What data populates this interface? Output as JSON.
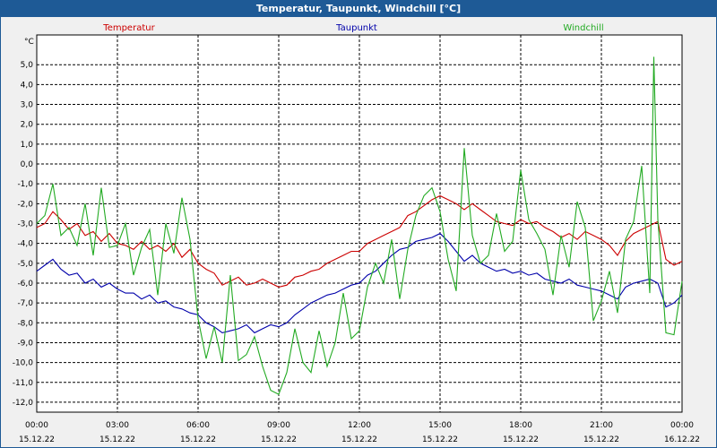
{
  "window": {
    "title": "Temperatur, Taupunkt, Windchill [°C]"
  },
  "colors": {
    "titlebar": "#1e5a96",
    "temperature": "#cc0000",
    "dewpoint": "#0000aa",
    "windchill": "#22aa22",
    "grid": "#000000"
  },
  "chart_data": {
    "type": "line",
    "ylabel": "°C",
    "ylim": [
      -12.5,
      6.5
    ],
    "xlim": [
      0,
      24
    ],
    "grid": true,
    "legend_placement": "top",
    "yticks": [
      "5,0",
      "4,0",
      "3,0",
      "2,0",
      "1,0",
      "0,0",
      "-1,0",
      "-2,0",
      "-3,0",
      "-4,0",
      "-5,0",
      "-6,0",
      "-7,0",
      "-8,0",
      "-9,0",
      "-10,0",
      "-11,0",
      "-12,0"
    ],
    "ytick_values": [
      5,
      4,
      3,
      2,
      1,
      0,
      -1,
      -2,
      -3,
      -4,
      -5,
      -6,
      -7,
      -8,
      -9,
      -10,
      -11,
      -12
    ],
    "xticks": [
      {
        "time": "00:00",
        "date": "15.12.22"
      },
      {
        "time": "03:00",
        "date": "15.12.22"
      },
      {
        "time": "06:00",
        "date": "15.12.22"
      },
      {
        "time": "09:00",
        "date": "15.12.22"
      },
      {
        "time": "12:00",
        "date": "15.12.22"
      },
      {
        "time": "15:00",
        "date": "15.12.22"
      },
      {
        "time": "18:00",
        "date": "15.12.22"
      },
      {
        "time": "21:00",
        "date": "15.12.22"
      },
      {
        "time": "00:00",
        "date": "16.12.22"
      }
    ],
    "series": [
      {
        "name": "Temperatur",
        "color": "#cc0000",
        "x": [
          0,
          0.3,
          0.6,
          0.9,
          1.2,
          1.5,
          1.8,
          2.1,
          2.4,
          2.7,
          3.0,
          3.3,
          3.6,
          3.9,
          4.2,
          4.5,
          4.8,
          5.1,
          5.4,
          5.7,
          6.0,
          6.3,
          6.6,
          6.9,
          7.2,
          7.5,
          7.8,
          8.1,
          8.4,
          8.7,
          9.0,
          9.3,
          9.6,
          9.9,
          10.2,
          10.5,
          10.8,
          11.1,
          11.4,
          11.7,
          12.0,
          12.3,
          12.6,
          12.9,
          13.2,
          13.5,
          13.8,
          14.1,
          14.4,
          14.7,
          15.0,
          15.3,
          15.6,
          15.9,
          16.2,
          16.5,
          16.8,
          17.1,
          17.4,
          17.7,
          18.0,
          18.3,
          18.6,
          18.9,
          19.2,
          19.5,
          19.8,
          20.1,
          20.4,
          20.7,
          21.0,
          21.3,
          21.6,
          21.9,
          22.2,
          22.5,
          22.8,
          23.1,
          23.4,
          23.7,
          24.0
        ],
        "values": [
          -3.2,
          -3.0,
          -2.4,
          -2.8,
          -3.3,
          -3.0,
          -3.6,
          -3.4,
          -3.9,
          -3.5,
          -4.0,
          -4.1,
          -4.3,
          -3.9,
          -4.3,
          -4.1,
          -4.4,
          -4.0,
          -4.7,
          -4.3,
          -5.0,
          -5.3,
          -5.5,
          -6.1,
          -5.9,
          -5.7,
          -6.1,
          -6.0,
          -5.8,
          -6.0,
          -6.2,
          -6.1,
          -5.7,
          -5.6,
          -5.4,
          -5.3,
          -5.0,
          -4.8,
          -4.6,
          -4.4,
          -4.4,
          -4.0,
          -3.8,
          -3.6,
          -3.4,
          -3.2,
          -2.6,
          -2.4,
          -2.1,
          -1.8,
          -1.6,
          -1.8,
          -2.0,
          -2.3,
          -2.0,
          -2.3,
          -2.6,
          -2.9,
          -3.0,
          -3.1,
          -2.8,
          -3.0,
          -2.9,
          -3.2,
          -3.4,
          -3.7,
          -3.5,
          -3.8,
          -3.4,
          -3.6,
          -3.8,
          -4.1,
          -4.6,
          -3.9,
          -3.5,
          -3.3,
          -3.1,
          -2.9,
          -4.8,
          -5.1,
          -4.9
        ]
      },
      {
        "name": "Taupunkt",
        "color": "#0000aa",
        "x": [
          0,
          0.3,
          0.6,
          0.9,
          1.2,
          1.5,
          1.8,
          2.1,
          2.4,
          2.7,
          3.0,
          3.3,
          3.6,
          3.9,
          4.2,
          4.5,
          4.8,
          5.1,
          5.4,
          5.7,
          6.0,
          6.3,
          6.6,
          6.9,
          7.2,
          7.5,
          7.8,
          8.1,
          8.4,
          8.7,
          9.0,
          9.3,
          9.6,
          9.9,
          10.2,
          10.5,
          10.8,
          11.1,
          11.4,
          11.7,
          12.0,
          12.3,
          12.6,
          12.9,
          13.2,
          13.5,
          13.8,
          14.1,
          14.4,
          14.7,
          15.0,
          15.3,
          15.6,
          15.9,
          16.2,
          16.5,
          16.8,
          17.1,
          17.4,
          17.7,
          18.0,
          18.3,
          18.6,
          18.9,
          19.2,
          19.5,
          19.8,
          20.1,
          20.4,
          20.7,
          21.0,
          21.3,
          21.6,
          21.9,
          22.2,
          22.5,
          22.8,
          23.1,
          23.4,
          23.7,
          24.0
        ],
        "values": [
          -5.4,
          -5.1,
          -4.8,
          -5.3,
          -5.6,
          -5.5,
          -6.0,
          -5.8,
          -6.2,
          -6.0,
          -6.3,
          -6.5,
          -6.5,
          -6.8,
          -6.6,
          -7.0,
          -6.9,
          -7.2,
          -7.3,
          -7.5,
          -7.6,
          -8.0,
          -8.2,
          -8.5,
          -8.4,
          -8.3,
          -8.1,
          -8.5,
          -8.3,
          -8.1,
          -8.2,
          -8.0,
          -7.6,
          -7.3,
          -7.0,
          -6.8,
          -6.6,
          -6.5,
          -6.3,
          -6.1,
          -6.0,
          -5.6,
          -5.4,
          -5.0,
          -4.6,
          -4.3,
          -4.2,
          -3.9,
          -3.8,
          -3.7,
          -3.5,
          -3.9,
          -4.4,
          -4.9,
          -4.6,
          -5.0,
          -5.2,
          -5.4,
          -5.3,
          -5.5,
          -5.4,
          -5.6,
          -5.5,
          -5.8,
          -5.9,
          -6.0,
          -5.8,
          -6.1,
          -6.2,
          -6.3,
          -6.4,
          -6.6,
          -6.8,
          -6.2,
          -6.0,
          -5.9,
          -5.8,
          -6.0,
          -7.2,
          -7.0,
          -6.6
        ]
      },
      {
        "name": "Windchill",
        "color": "#22aa22",
        "x": [
          0,
          0.3,
          0.6,
          0.9,
          1.2,
          1.5,
          1.8,
          2.1,
          2.4,
          2.7,
          3.0,
          3.3,
          3.6,
          3.9,
          4.2,
          4.5,
          4.8,
          5.1,
          5.4,
          5.7,
          6.0,
          6.3,
          6.6,
          6.9,
          7.2,
          7.5,
          7.8,
          8.1,
          8.4,
          8.7,
          9.0,
          9.3,
          9.6,
          9.9,
          10.2,
          10.5,
          10.8,
          11.1,
          11.4,
          11.7,
          12.0,
          12.3,
          12.6,
          12.9,
          13.2,
          13.5,
          13.8,
          14.1,
          14.4,
          14.7,
          15.0,
          15.3,
          15.6,
          15.9,
          16.2,
          16.5,
          16.8,
          17.1,
          17.4,
          17.7,
          18.0,
          18.3,
          18.6,
          18.9,
          19.2,
          19.5,
          19.8,
          20.1,
          20.4,
          20.7,
          21.0,
          21.3,
          21.6,
          21.9,
          22.2,
          22.5,
          22.8,
          22.95,
          23.1,
          23.4,
          23.7,
          24.0
        ],
        "values": [
          -3.0,
          -2.6,
          -1.0,
          -3.6,
          -3.2,
          -4.1,
          -2.0,
          -4.6,
          -1.2,
          -4.2,
          -4.1,
          -3.0,
          -5.6,
          -4.2,
          -3.3,
          -6.6,
          -3.0,
          -4.5,
          -1.7,
          -3.8,
          -7.8,
          -9.8,
          -8.2,
          -10.0,
          -5.6,
          -9.9,
          -9.6,
          -8.7,
          -10.2,
          -11.4,
          -11.6,
          -10.5,
          -8.3,
          -10.0,
          -10.5,
          -8.4,
          -10.2,
          -9.0,
          -6.5,
          -8.8,
          -8.4,
          -6.2,
          -5.0,
          -6.0,
          -3.8,
          -6.8,
          -4.3,
          -2.6,
          -1.6,
          -1.2,
          -2.4,
          -4.8,
          -6.4,
          0.8,
          -3.6,
          -5.0,
          -4.6,
          -2.5,
          -4.4,
          -3.9,
          -0.3,
          -2.8,
          -3.5,
          -4.3,
          -6.6,
          -3.6,
          -5.2,
          -1.9,
          -3.2,
          -7.9,
          -6.9,
          -5.4,
          -7.5,
          -3.8,
          -2.9,
          -0.1,
          -6.5,
          5.4,
          -2.8,
          -8.5,
          -8.6,
          -5.9
        ]
      }
    ]
  }
}
